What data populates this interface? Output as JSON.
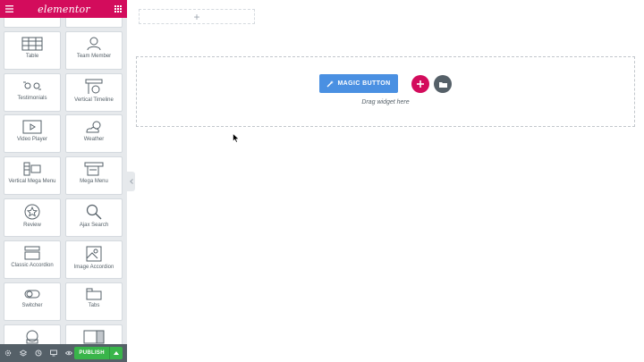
{
  "topbar": {
    "logo_text": "elementor",
    "menu_icon": "hamburger-icon",
    "grid_icon": "apps-grid-icon"
  },
  "widgets": [
    {
      "label": "Table",
      "icon": "table-icon"
    },
    {
      "label": "Team Member",
      "icon": "team-member-icon"
    },
    {
      "label": "Testimonials",
      "icon": "testimonials-icon"
    },
    {
      "label": "Vertical Timeline",
      "icon": "vertical-timeline-icon"
    },
    {
      "label": "Video Player",
      "icon": "video-player-icon"
    },
    {
      "label": "Weather",
      "icon": "weather-icon"
    },
    {
      "label": "Vertical Mega Menu",
      "icon": "vertical-mega-menu-icon"
    },
    {
      "label": "Mega Menu",
      "icon": "mega-menu-icon"
    },
    {
      "label": "Review",
      "icon": "review-star-icon"
    },
    {
      "label": "Ajax Search",
      "icon": "search-icon"
    },
    {
      "label": "Classic Accordion",
      "icon": "accordion-icon"
    },
    {
      "label": "Image Accordion",
      "icon": "image-accordion-icon"
    },
    {
      "label": "Switcher",
      "icon": "switcher-toggle-icon"
    },
    {
      "label": "Tabs",
      "icon": "tabs-icon"
    }
  ],
  "bottombar": {
    "icons": [
      "settings-gear-icon",
      "navigator-layers-icon",
      "history-icon",
      "responsive-desktop-icon",
      "preview-eye-icon"
    ],
    "publish_label": "PUBLISH"
  },
  "canvas": {
    "add_section_symbol": "+",
    "magic_button_label": "MAGIC BUTTON",
    "drag_hint": "Drag widget here"
  },
  "colors": {
    "brand": "#d30c5c",
    "magic": "#4a90e2",
    "publish": "#39b54a",
    "panel": "#e6e9ec",
    "dark": "#556068"
  }
}
